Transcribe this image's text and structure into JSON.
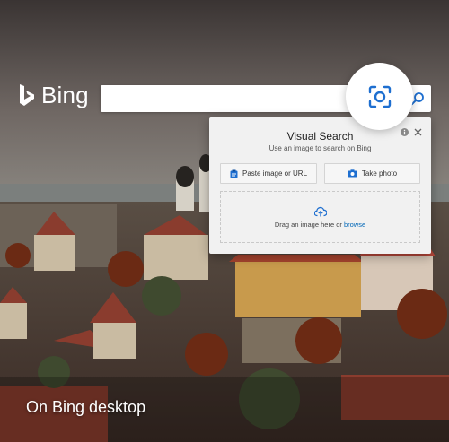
{
  "brand": {
    "name": "Bing"
  },
  "search": {
    "value": "",
    "placeholder": ""
  },
  "visual_search": {
    "title": "Visual Search",
    "subtitle": "Use an image to search on Bing",
    "paste_label": "Paste image or URL",
    "photo_label": "Take photo",
    "drop_text": "Drag an image here or",
    "browse_label": "browse"
  },
  "caption": "On Bing desktop",
  "icons": [
    "bing-logo-icon",
    "visual-search-icon",
    "search-icon",
    "info-icon",
    "close-icon",
    "paste-icon",
    "camera-icon",
    "upload-icon"
  ],
  "colors": {
    "accent": "#1e6fd0",
    "link": "#0067b8",
    "panel": "#f1f1f1"
  }
}
